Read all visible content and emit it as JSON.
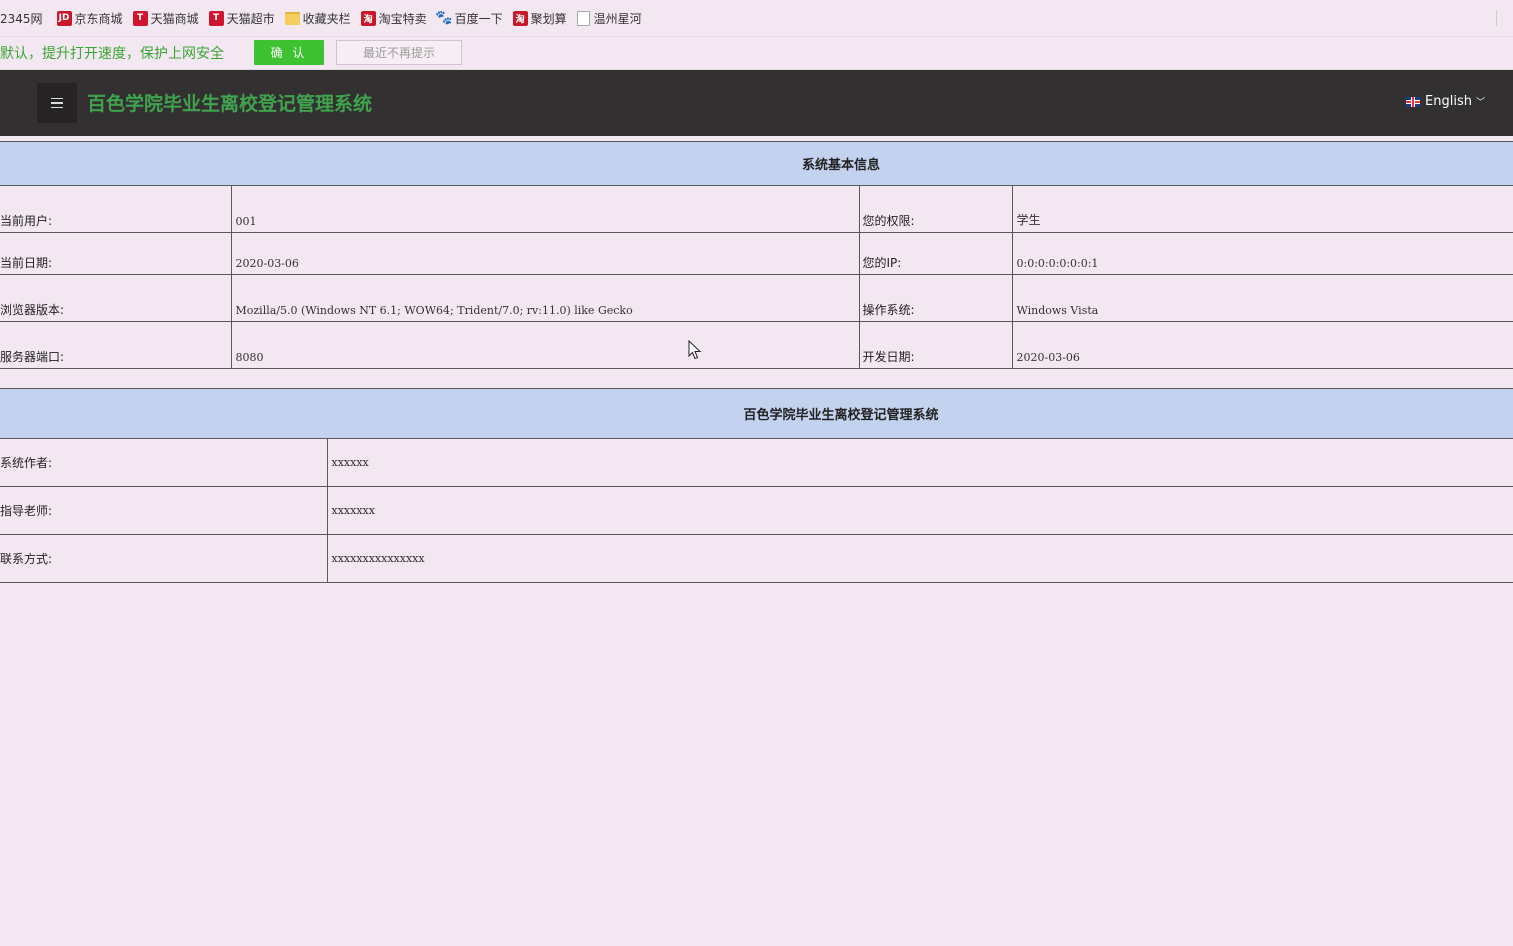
{
  "bookmarks": [
    {
      "label": "2345网",
      "icon": "none"
    },
    {
      "label": "京东商城",
      "icon": "jd-icon",
      "glyph": "JD"
    },
    {
      "label": "天猫商城",
      "icon": "tmall-icon",
      "glyph": "T"
    },
    {
      "label": "天猫超市",
      "icon": "tmall-icon",
      "glyph": "T"
    },
    {
      "label": "收藏夹栏",
      "icon": "folder-icon"
    },
    {
      "label": "淘宝特卖",
      "icon": "taobao-icon",
      "glyph": "淘"
    },
    {
      "label": "百度一下",
      "icon": "baidu-paw-icon",
      "glyph": "🐾"
    },
    {
      "label": "聚划算",
      "icon": "taobao-icon",
      "glyph": "淘"
    },
    {
      "label": "温州星河",
      "icon": "page-icon"
    }
  ],
  "notice": {
    "text": "默认，提升打开速度，保护上网安全",
    "confirm_label": "确 认",
    "no_remind_label": "最近不再提示"
  },
  "header": {
    "title": "百色学院毕业生离校登记管理系统",
    "language": "English"
  },
  "system_info": {
    "heading": "系统基本信息",
    "rows": [
      {
        "label1": "当前用户:",
        "value1": "001",
        "label2": "您的权限:",
        "value2": "学生"
      },
      {
        "label1": "当前日期:",
        "value1": "2020-03-06",
        "label2": "您的IP:",
        "value2": "0:0:0:0:0:0:0:1"
      },
      {
        "label1": "浏览器版本:",
        "value1": "Mozilla/5.0 (Windows NT 6.1; WOW64; Trident/7.0; rv:11.0) like Gecko",
        "label2": "操作系统:",
        "value2": "Windows Vista"
      },
      {
        "label1": "服务器端口:",
        "value1": "8080",
        "label2": "开发日期:",
        "value2": "2020-03-06"
      }
    ]
  },
  "about": {
    "heading": "百色学院毕业生离校登记管理系统",
    "rows": [
      {
        "label": "系统作者:",
        "value": "xxxxxx"
      },
      {
        "label": "指导老师:",
        "value": "xxxxxxx"
      },
      {
        "label": "联系方式:",
        "value": "xxxxxxxxxxxxxxx"
      }
    ]
  },
  "colors": {
    "page_bg": "#f3e8f1",
    "header_bg": "#333031",
    "title_green": "#3fa34d",
    "table_heading_bg": "#c3d3ef",
    "confirm_green": "#3ec231"
  }
}
